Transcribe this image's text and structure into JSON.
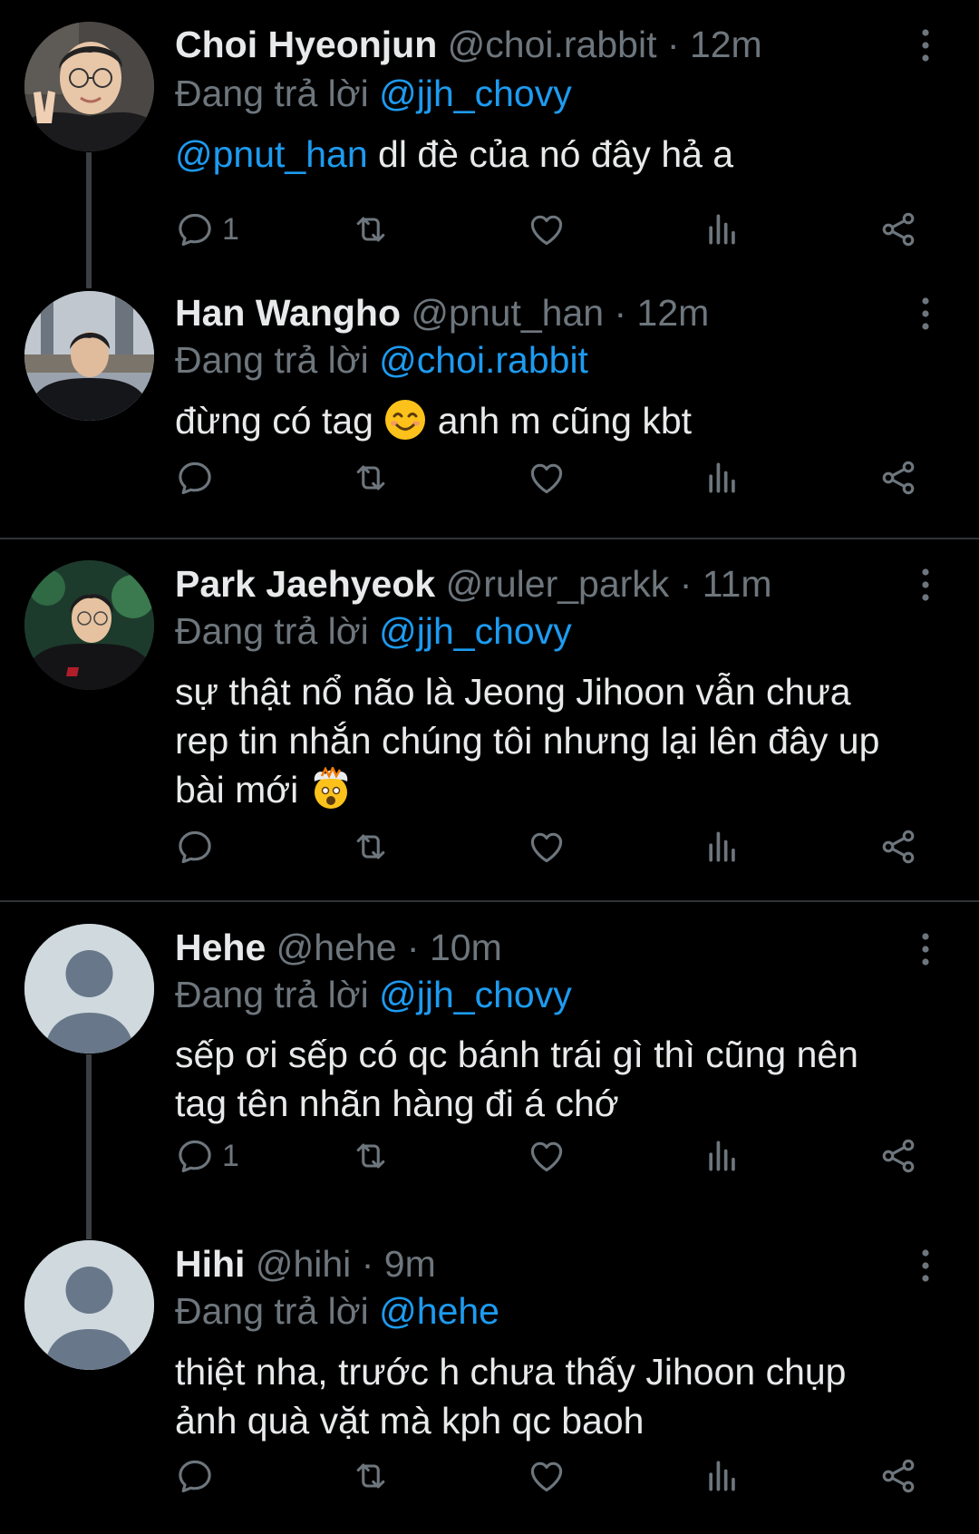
{
  "separator": "·",
  "replying_prefix": "Đang trả lời",
  "tweets": [
    {
      "name": "Choi Hyeonjun",
      "handle": "@choi.rabbit",
      "time": "12m",
      "reply_to": "@jjh_chovy",
      "mention": "@pnut_han",
      "text": " dl đè của nó đây hả a",
      "reply_count": "1"
    },
    {
      "name": "Han Wangho",
      "handle": "@pnut_han",
      "time": "12m",
      "reply_to": "@choi.rabbit",
      "text_a": "đừng có tag ",
      "text_b": " anh m cũng kbt",
      "reply_count": ""
    },
    {
      "name": "Park Jaehyeok",
      "handle": "@ruler_parkk",
      "time": "11m",
      "reply_to": "@jjh_chovy",
      "text_lines": [
        "sự thật nổ não là Jeong Jihoon vẫn chưa",
        "rep tin nhắn chúng tôi nhưng lại lên đây up",
        "bài mới "
      ],
      "reply_count": ""
    },
    {
      "name": "Hehe",
      "handle": "@hehe",
      "time": "10m",
      "reply_to": "@jjh_chovy",
      "text_lines": [
        "sếp ơi sếp có qc bánh trái gì thì cũng nên",
        "tag tên nhãn hàng đi á chớ"
      ],
      "reply_count": "1"
    },
    {
      "name": "Hihi",
      "handle": "@hihi",
      "time": "9m",
      "reply_to": "@hehe",
      "text_lines": [
        "thiệt nha, trước h chưa thấy Jihoon chụp",
        "ảnh quà vặt mà kph qc baoh"
      ],
      "reply_count": ""
    }
  ],
  "icons": {
    "reply": "speech-bubble-icon",
    "retweet": "retweet-icon",
    "like": "heart-icon",
    "views": "bar-chart-icon",
    "share": "share-icon",
    "more": "vertical-ellipsis-icon"
  },
  "colors": {
    "background": "#000000",
    "text": "#e7e9ea",
    "muted": "#6e767d",
    "link": "#1d9bf0",
    "divider": "#2f3336"
  }
}
